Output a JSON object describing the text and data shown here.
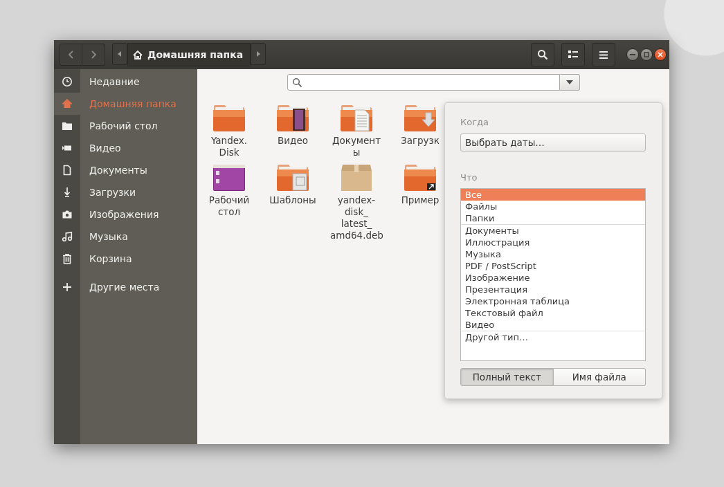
{
  "header": {
    "location": "Домашняя папка"
  },
  "sidebar": {
    "items": [
      {
        "label": "Недавние",
        "selected": false
      },
      {
        "label": "Домашняя папка",
        "selected": true
      },
      {
        "label": "Рабочий стол",
        "selected": false
      },
      {
        "label": "Видео",
        "selected": false
      },
      {
        "label": "Документы",
        "selected": false
      },
      {
        "label": "Загрузки",
        "selected": false
      },
      {
        "label": "Изображения",
        "selected": false
      },
      {
        "label": "Музыка",
        "selected": false
      },
      {
        "label": "Корзина",
        "selected": false
      }
    ],
    "other": {
      "label": "Другие места"
    }
  },
  "files": [
    {
      "name": "Yandex. Disk",
      "kind": "folder"
    },
    {
      "name": "Видео",
      "kind": "folder"
    },
    {
      "name": "Документ ы",
      "kind": "folder"
    },
    {
      "name": "Загрузк",
      "kind": "folder"
    },
    {
      "name": "Рабочий стол",
      "kind": "desktop"
    },
    {
      "name": "Шаблоны",
      "kind": "folder"
    },
    {
      "name": "yandex- disk_ latest_ amd64.deb",
      "kind": "package"
    },
    {
      "name": "Пример",
      "kind": "folder"
    }
  ],
  "popover": {
    "when_label": "Когда",
    "date_button": "Выбрать даты…",
    "what_label": "Что",
    "type_groups": [
      [
        {
          "label": "Все",
          "selected": true
        },
        {
          "label": "Файлы",
          "selected": false
        },
        {
          "label": "Папки",
          "selected": false
        }
      ],
      [
        {
          "label": "Документы",
          "selected": false
        },
        {
          "label": "Иллюстрация",
          "selected": false
        },
        {
          "label": "Музыка",
          "selected": false
        },
        {
          "label": "PDF / PostScript",
          "selected": false
        },
        {
          "label": "Изображение",
          "selected": false
        },
        {
          "label": "Презентация",
          "selected": false
        },
        {
          "label": "Электронная таблица",
          "selected": false
        },
        {
          "label": "Текстовый файл",
          "selected": false
        },
        {
          "label": "Видео",
          "selected": false
        }
      ],
      [
        {
          "label": "Другой тип…",
          "selected": false
        }
      ]
    ],
    "modes": [
      {
        "label": "Полный текст",
        "selected": true
      },
      {
        "label": "Имя файла",
        "selected": false
      }
    ]
  }
}
